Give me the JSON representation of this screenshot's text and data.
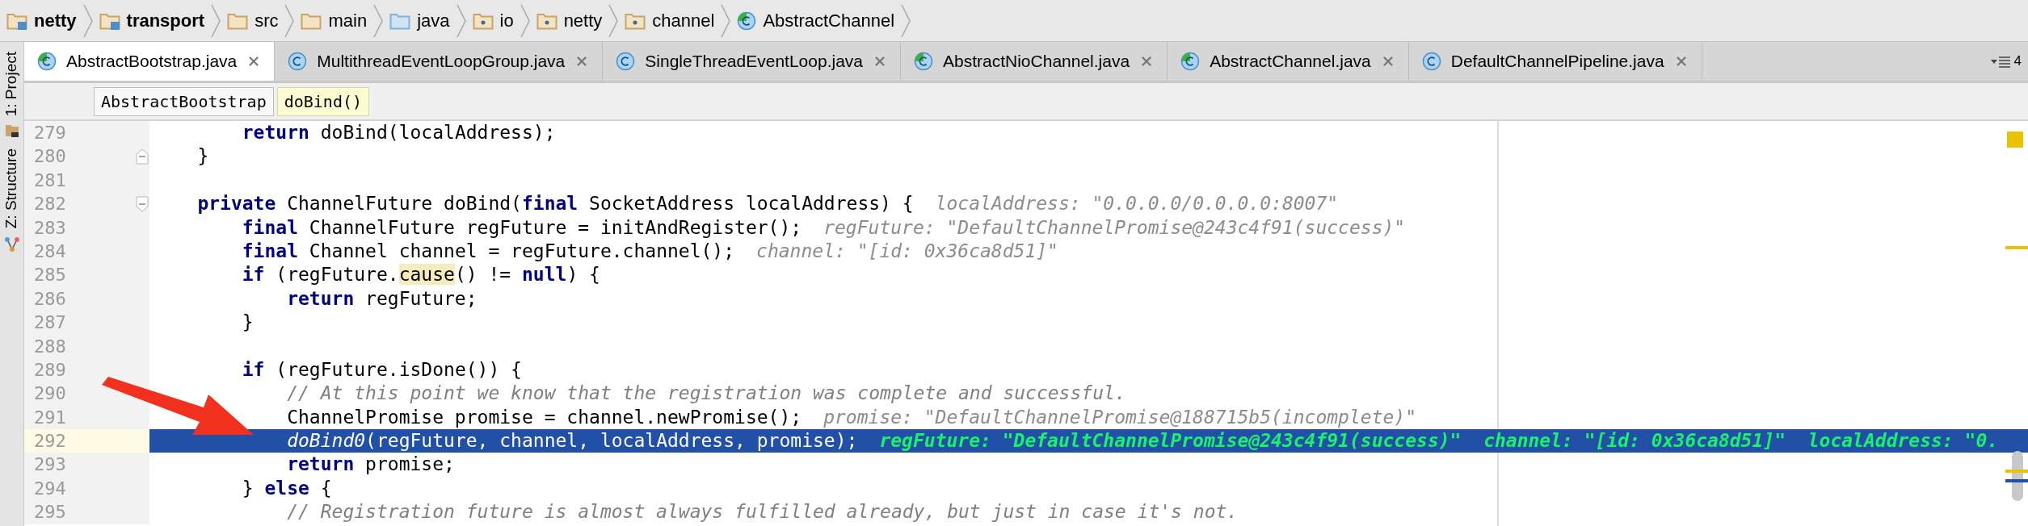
{
  "breadcrumbs": [
    {
      "label": "netty",
      "kind": "module"
    },
    {
      "label": "transport",
      "kind": "module"
    },
    {
      "label": "src",
      "kind": "folder"
    },
    {
      "label": "main",
      "kind": "folder"
    },
    {
      "label": "java",
      "kind": "source-root"
    },
    {
      "label": "io",
      "kind": "package"
    },
    {
      "label": "netty",
      "kind": "package"
    },
    {
      "label": "channel",
      "kind": "package"
    },
    {
      "label": "AbstractChannel",
      "kind": "class"
    }
  ],
  "tool_strip": [
    {
      "label": "1: Project",
      "kind": "project"
    },
    {
      "label": "Z: Structure",
      "kind": "structure"
    }
  ],
  "tabs": [
    {
      "label": "AbstractBootstrap.java",
      "selected": true,
      "abstract": true
    },
    {
      "label": "MultithreadEventLoopGroup.java",
      "selected": false,
      "abstract": false
    },
    {
      "label": "SingleThreadEventLoop.java",
      "selected": false,
      "abstract": false
    },
    {
      "label": "AbstractNioChannel.java",
      "selected": false,
      "abstract": true
    },
    {
      "label": "AbstractChannel.java",
      "selected": false,
      "abstract": true
    },
    {
      "label": "DefaultChannelPipeline.java",
      "selected": false,
      "abstract": false
    }
  ],
  "hidden_tab_count": "4",
  "method_path": [
    {
      "label": "AbstractBootstrap",
      "selected": false
    },
    {
      "label": "doBind()",
      "selected": true
    }
  ],
  "lines": [
    {
      "number": "279",
      "selected": false,
      "fold_start": false,
      "fold_end": false,
      "tokens": [
        {
          "text": "        return",
          "kind": "keyword"
        },
        {
          "text": " doBind(localAddress);",
          "kind": "plain"
        }
      ]
    },
    {
      "number": "280",
      "selected": false,
      "fold_start": false,
      "fold_end": true,
      "tokens": [
        {
          "text": "    }",
          "kind": "plain"
        }
      ]
    },
    {
      "number": "281",
      "selected": false,
      "fold_start": false,
      "fold_end": false
    },
    {
      "number": "282",
      "selected": false,
      "fold_start": true,
      "fold_end": false,
      "tokens": [
        {
          "text": "    private",
          "kind": "keyword"
        },
        {
          "text": " ChannelFuture doBind(",
          "kind": "plain"
        },
        {
          "text": "final",
          "kind": "keyword"
        },
        {
          "text": " SocketAddress localAddress) {",
          "kind": "plain"
        }
      ],
      "hint": "localAddress: \"0.0.0.0/0.0.0.0:8007\""
    },
    {
      "number": "283",
      "selected": false,
      "fold_start": false,
      "fold_end": false,
      "tokens": [
        {
          "text": "        final",
          "kind": "keyword"
        },
        {
          "text": " ChannelFuture regFuture = initAndRegister();",
          "kind": "plain"
        }
      ],
      "hint": "regFuture: \"DefaultChannelPromise@243c4f91(success)\""
    },
    {
      "number": "284",
      "selected": false,
      "fold_start": false,
      "fold_end": false,
      "tokens": [
        {
          "text": "        final",
          "kind": "keyword"
        },
        {
          "text": " Channel channel = regFuture.channel();",
          "kind": "plain"
        }
      ],
      "hint": "channel: \"[id: 0x36ca8d51]\""
    },
    {
      "number": "285",
      "selected": false,
      "fold_start": false,
      "fold_end": false,
      "tokens": [
        {
          "text": "        if",
          "kind": "keyword"
        },
        {
          "text": " (regFuture.",
          "kind": "plain"
        },
        {
          "text": "cause",
          "kind": "usage"
        },
        {
          "text": "() != ",
          "kind": "plain"
        },
        {
          "text": "null",
          "kind": "keyword"
        },
        {
          "text": ") {",
          "kind": "plain"
        }
      ]
    },
    {
      "number": "286",
      "selected": false,
      "fold_start": false,
      "fold_end": false,
      "tokens": [
        {
          "text": "            return",
          "kind": "keyword"
        },
        {
          "text": " regFuture;",
          "kind": "plain"
        }
      ]
    },
    {
      "number": "287",
      "selected": false,
      "fold_start": false,
      "fold_end": false,
      "tokens": [
        {
          "text": "        }",
          "kind": "plain"
        }
      ]
    },
    {
      "number": "288",
      "selected": false,
      "fold_start": false,
      "fold_end": false
    },
    {
      "number": "289",
      "selected": false,
      "fold_start": false,
      "fold_end": false,
      "tokens": [
        {
          "text": "        if",
          "kind": "keyword"
        },
        {
          "text": " (regFuture.isDone()) {",
          "kind": "plain"
        }
      ]
    },
    {
      "number": "290",
      "selected": false,
      "fold_start": false,
      "fold_end": false,
      "tokens": [
        {
          "text": "            // At this point we know that the registration was complete and successful.",
          "kind": "comment"
        }
      ]
    },
    {
      "number": "291",
      "selected": false,
      "fold_start": false,
      "fold_end": false,
      "tokens": [
        {
          "text": "            ChannelPromise promise = channel.newPromise();",
          "kind": "plain"
        }
      ],
      "hint": "promise: \"DefaultChannelPromise@188715b5(incomplete)\""
    },
    {
      "number": "292",
      "selected": true,
      "fold_start": false,
      "fold_end": false,
      "tokens": [
        {
          "text": "            doBind0",
          "kind": "static"
        },
        {
          "text": "(regFuture, channel, localAddress, promise);",
          "kind": "plain"
        }
      ],
      "hint": "regFuture: \"DefaultChannelPromise@243c4f91(success)\"  channel: \"[id: 0x36ca8d51]\"  localAddress: \"0."
    },
    {
      "number": "293",
      "selected": false,
      "fold_start": false,
      "fold_end": false,
      "tokens": [
        {
          "text": "            return",
          "kind": "keyword"
        },
        {
          "text": " promise;",
          "kind": "plain"
        }
      ]
    },
    {
      "number": "294",
      "selected": false,
      "fold_start": false,
      "fold_end": false,
      "tokens": [
        {
          "text": "        } ",
          "kind": "plain"
        },
        {
          "text": "else",
          "kind": "keyword"
        },
        {
          "text": " {",
          "kind": "plain"
        }
      ]
    },
    {
      "number": "295",
      "selected": false,
      "fold_start": false,
      "fold_end": false,
      "tokens": [
        {
          "text": "            // Registration future is almost always fulfilled already, but just in case it's not.",
          "kind": "comment"
        }
      ]
    }
  ]
}
